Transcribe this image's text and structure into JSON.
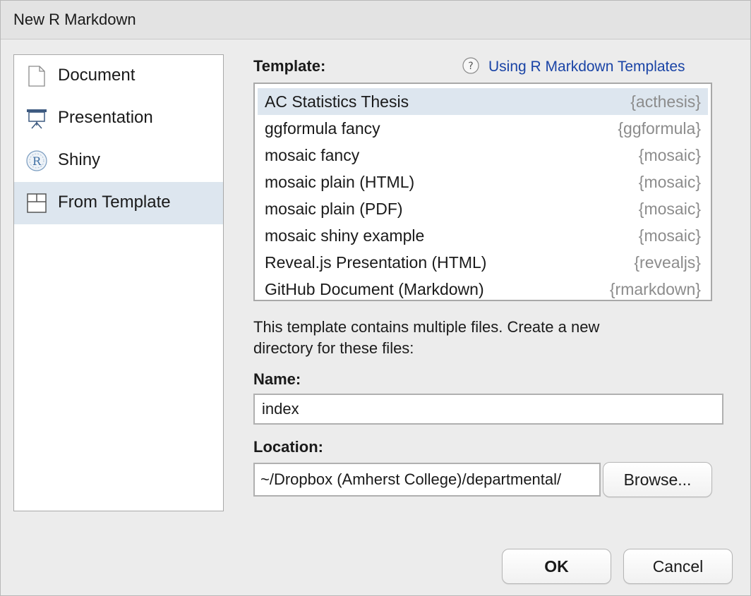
{
  "window": {
    "title": "New R Markdown"
  },
  "sidebar": {
    "items": [
      {
        "label": "Document",
        "icon": "document-icon"
      },
      {
        "label": "Presentation",
        "icon": "presentation-icon"
      },
      {
        "label": "Shiny",
        "icon": "shiny-icon"
      },
      {
        "label": "From Template",
        "icon": "template-icon",
        "selected": true
      }
    ]
  },
  "template_section": {
    "label": "Template:",
    "help_link": "Using R Markdown Templates",
    "templates": [
      {
        "name": "AC Statistics Thesis",
        "package": "{acthesis}",
        "selected": true
      },
      {
        "name": "ggformula fancy",
        "package": "{ggformula}"
      },
      {
        "name": "mosaic fancy",
        "package": "{mosaic}"
      },
      {
        "name": "mosaic plain (HTML)",
        "package": "{mosaic}"
      },
      {
        "name": "mosaic plain (PDF)",
        "package": "{mosaic}"
      },
      {
        "name": "mosaic shiny example",
        "package": "{mosaic}"
      },
      {
        "name": "Reveal.js Presentation (HTML)",
        "package": "{revealjs}"
      },
      {
        "name": "GitHub Document (Markdown)",
        "package": "{rmarkdown}"
      }
    ]
  },
  "description": {
    "line1": "This template contains multiple files. Create a new",
    "line2": "directory for these files:"
  },
  "name_field": {
    "label": "Name:",
    "value": "index"
  },
  "location_field": {
    "label": "Location:",
    "value": "~/Dropbox (Amherst College)/departmental/",
    "browse_label": "Browse..."
  },
  "buttons": {
    "ok_label": "OK",
    "cancel_label": "Cancel"
  },
  "colors": {
    "selection": "#dde6ef",
    "link": "#1a44a6",
    "package_text": "#8c8c8c"
  }
}
